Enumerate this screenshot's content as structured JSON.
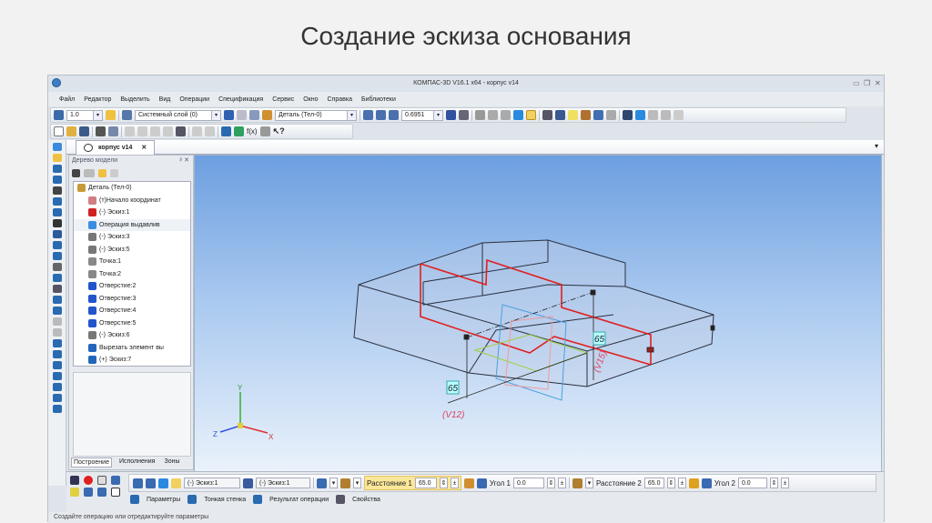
{
  "slide_title": "Создание эскиза основания",
  "window": {
    "title": "КОМПАС-3D V16.1 x64 - корпус v14"
  },
  "menu": [
    "Файл",
    "Редактор",
    "Выделить",
    "Вид",
    "Операции",
    "Спецификация",
    "Сервис",
    "Окно",
    "Справка",
    "Библиотеки"
  ],
  "toolbar": {
    "step_value": "1.0",
    "layer": "Системный слой (0)",
    "part": "Деталь (Тел-0)",
    "zoom": "0.6951",
    "fx_label": "f(x)"
  },
  "document_tab": "корпус v14",
  "tree": {
    "title": "Дерево модели",
    "items": [
      {
        "label": "Деталь (Тел-0)",
        "color": "#c89a3a"
      },
      {
        "label": "(т)Начало координат",
        "color": "#d08080"
      },
      {
        "label": "(-) Эскиз:1",
        "color": "#d02020"
      },
      {
        "label": "Операция выдавлив",
        "color": "#3a8ee0"
      },
      {
        "label": "(-) Эскиз:3",
        "color": "#777777"
      },
      {
        "label": "(-) Эскиз:5",
        "color": "#777777"
      },
      {
        "label": "Точка:1",
        "color": "#888888"
      },
      {
        "label": "Точка:2",
        "color": "#888888"
      },
      {
        "label": "Отверстие:2",
        "color": "#2255cc"
      },
      {
        "label": "Отверстие:3",
        "color": "#2255cc"
      },
      {
        "label": "Отверстие:4",
        "color": "#2255cc"
      },
      {
        "label": "Отверстие:5",
        "color": "#2255cc"
      },
      {
        "label": "(-) Эскиз:6",
        "color": "#777777"
      },
      {
        "label": "Вырезать элемент вы",
        "color": "#2266bb"
      },
      {
        "label": "(+) Эскиз:7",
        "color": "#2266bb"
      }
    ],
    "bottom_tabs": [
      "Построение",
      "Исполнения",
      "Зоны"
    ]
  },
  "viewport": {
    "dim1": "65",
    "dim1_var": "(V12)",
    "dim2": "65",
    "dim2_var": "(V15)",
    "axes": {
      "x": "X",
      "y": "Y",
      "z": "Z"
    }
  },
  "params": {
    "sketch_a": "(-) Эскиз:1",
    "sketch_b": "(-) Эскиз:1",
    "distance1_label": "Расстояние 1",
    "distance1_value": "65.0",
    "angle1_label": "Угол 1",
    "angle1_value": "0.0",
    "distance2_label": "Расстояние 2",
    "distance2_value": "65.0",
    "angle2_label": "Угол 2",
    "angle2_value": "0.0",
    "plusminus": "±",
    "tabs": [
      "Параметры",
      "Тонкая стенка",
      "Результат операции",
      "Свойства"
    ]
  },
  "status": "Создайте операцию или отредактируйте параметры"
}
